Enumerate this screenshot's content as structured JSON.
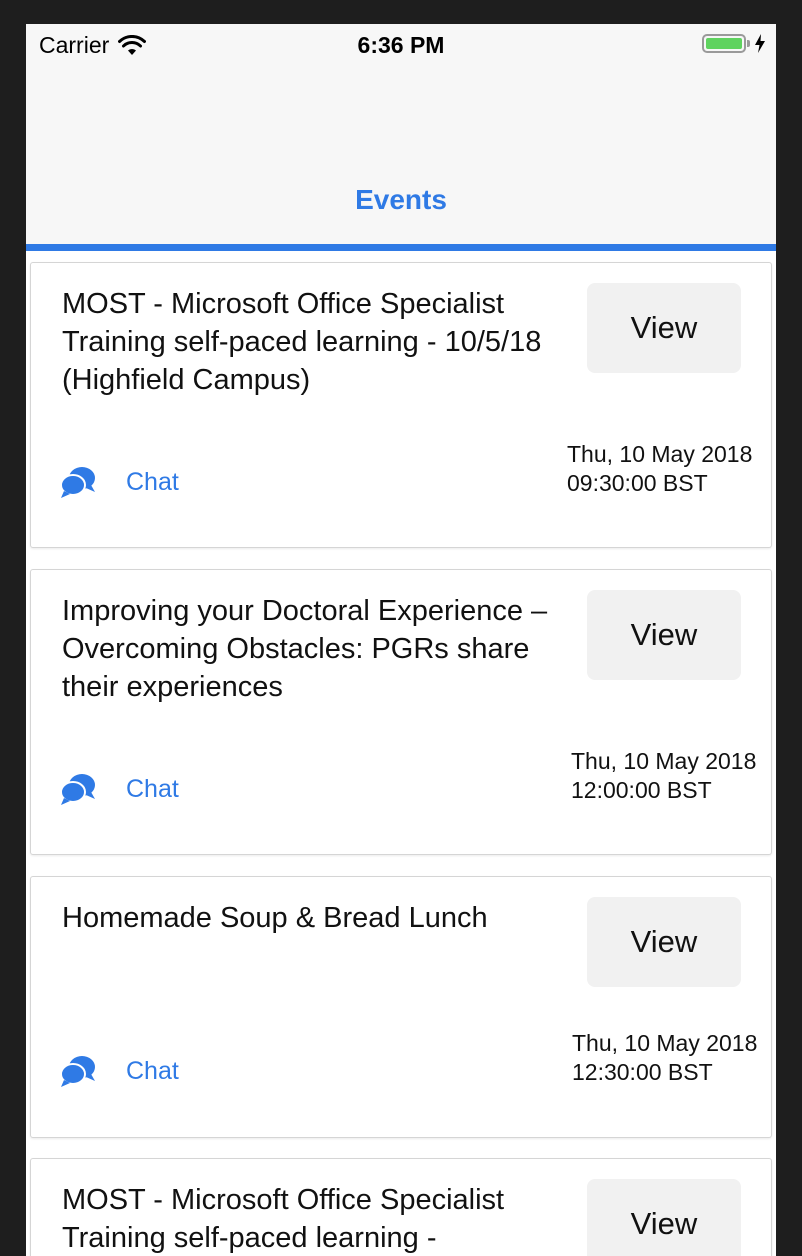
{
  "status_bar": {
    "carrier": "Carrier",
    "time": "6:36 PM"
  },
  "nav": {
    "tab_title": "Events"
  },
  "colors": {
    "accent": "#2f7ae5",
    "header_bg": "#f7f7f7",
    "button_bg": "#f1f1f1"
  },
  "events": [
    {
      "title": "MOST - Microsoft Office Specialist Training self-paced learning - 10/5/18 (Highfield Campus)",
      "view_label": "View",
      "chat_label": "Chat",
      "date": "Thu, 10 May 2018 09:30:00 BST"
    },
    {
      "title": "Improving your Doctoral Experience – Overcoming Obstacles: PGRs share their experiences",
      "view_label": "View",
      "chat_label": "Chat",
      "date": "Thu, 10 May 2018 12:00:00 BST"
    },
    {
      "title": "Homemade Soup & Bread Lunch",
      "view_label": "View",
      "chat_label": "Chat",
      "date": "Thu, 10 May 2018 12:30:00 BST"
    },
    {
      "title": "MOST - Microsoft Office Specialist Training self-paced learning -",
      "view_label": "View",
      "chat_label": "",
      "date": ""
    }
  ]
}
